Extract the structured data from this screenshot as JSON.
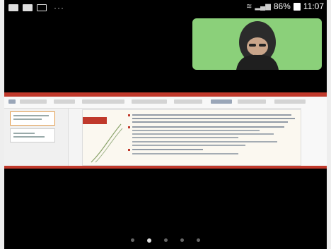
{
  "status_bar": {
    "left_icons": [
      "notification-icon",
      "image-icon",
      "screen-icon"
    ],
    "overflow_indicator": "···",
    "battery_percent": "86%",
    "time": "11:07"
  },
  "video_call": {
    "background_color": "#8bd07a"
  },
  "shared_screen": {
    "accent_color": "#c0392b"
  },
  "pager": {
    "total_pages": 5,
    "current_page": 2
  }
}
